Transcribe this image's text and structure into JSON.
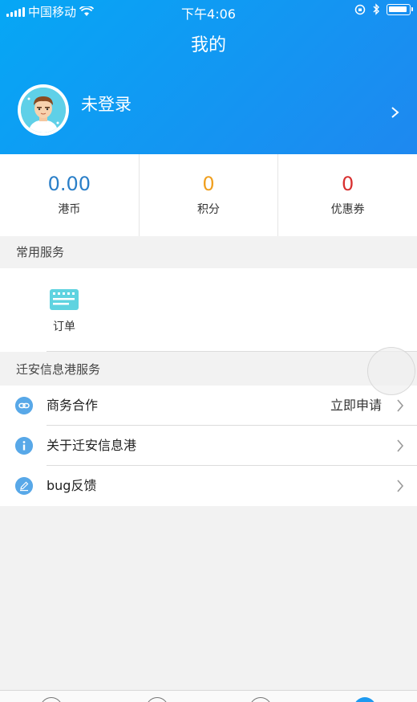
{
  "status_bar": {
    "carrier": "中国移动",
    "time": "下午4:06"
  },
  "header": {
    "title": "我的",
    "login_label": "未登录"
  },
  "stats": [
    {
      "value": "0.00",
      "label": "港币",
      "color": "#2a7fc8"
    },
    {
      "value": "0",
      "label": "积分",
      "color": "#f0a020"
    },
    {
      "value": "0",
      "label": "优惠券",
      "color": "#d83030"
    }
  ],
  "common_services": {
    "title": "常用服务",
    "items": [
      {
        "label": "订单",
        "icon": "keyboard-icon"
      }
    ]
  },
  "port_services": {
    "title": "迁安信息港服务",
    "items": [
      {
        "label": "商务合作",
        "value": "立即申请",
        "icon": "link-icon"
      },
      {
        "label": "关于迁安信息港",
        "value": "",
        "icon": "info-icon"
      },
      {
        "label": "bug反馈",
        "value": "",
        "icon": "edit-icon"
      }
    ]
  },
  "colors": {
    "header_gradient_start": "#06a7f5",
    "header_gradient_end": "#1e88f0",
    "list_icon": "#58a8e8",
    "tab_active": "#1e9af0"
  }
}
